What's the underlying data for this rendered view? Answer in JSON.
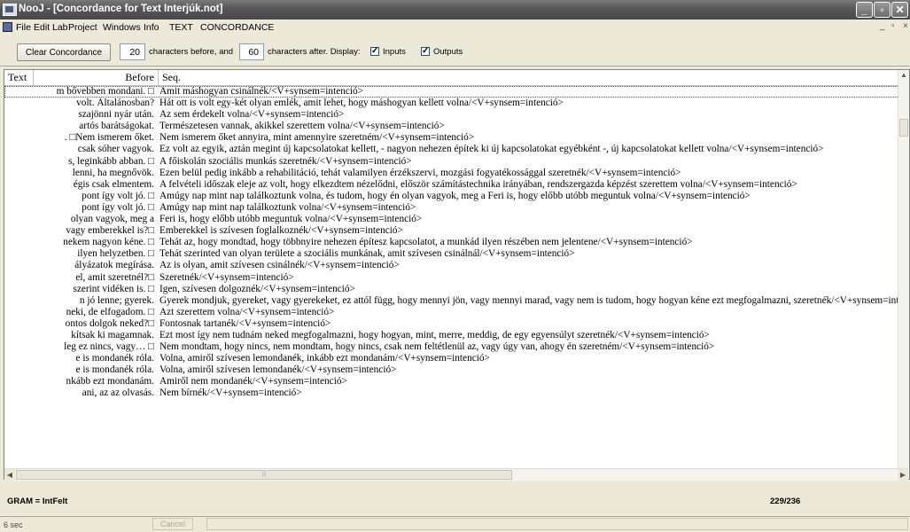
{
  "window": {
    "title": "NooJ - [Concordance for Text Interjúk.not]",
    "buttons": [
      "_",
      "▫",
      "✕"
    ]
  },
  "menu": {
    "items": [
      "File",
      "Edit",
      "Lab",
      "Project",
      "Windows",
      "Info",
      "TEXT",
      "CONCORDANCE"
    ],
    "right_controls": [
      "_",
      "▫",
      "×"
    ]
  },
  "toolbar": {
    "clear_label": "Clear Concordance",
    "chars_before": "20",
    "chars_before_label": "characters before, and",
    "chars_after": "60",
    "chars_after_label": "characters after.  Display:",
    "inputs_label": "Inputs",
    "inputs_checked": true,
    "outputs_label": "Outputs",
    "outputs_checked": true
  },
  "grid": {
    "columns": [
      "Text",
      "Before",
      "Seq."
    ],
    "rows": [
      {
        "before": "m bővebben mondani. □",
        "seq": "Amit máshogyan csinálnék/<V+synsem=intenció>"
      },
      {
        "before": "volt. Általánosban?",
        "seq": "Hát ott is volt egy-két olyan emlék, amit lehet, hogy máshogyan kellett volna/<V+synsem=intenció>"
      },
      {
        "before": "szajönni nyár után.",
        "seq": "Az sem érdekelt volna/<V+synsem=intenció>"
      },
      {
        "before": "artós barátságokat.",
        "seq": "Természetesen vannak, akikkel szerettem volna/<V+synsem=intenció>"
      },
      {
        "before": ". □Nem ismerem őket.",
        "seq": "Nem ismerem őket annyira, mint amennyire szeretném/<V+synsem=intenció>"
      },
      {
        "before": "csak sóher vagyok.",
        "seq": "Ez volt az egyik, aztán megint új kapcsolatokat kellett, - nagyon nehezen építek ki új kapcsolatokat egyébként -, új kapcsolatokat kellett volna/<V+synsem=intenció>"
      },
      {
        "before": "s, leginkább abban. □",
        "seq": "A főiskolán szociális munkás szeretnék/<V+synsem=intenció>"
      },
      {
        "before": "lenni, ha megnővök.",
        "seq": "Ezen belül pedig inkább a rehabilitáció, tehát valamilyen érzékszervi, mozgási fogyatékossággal szeretnék/<V+synsem=intenció>"
      },
      {
        "before": "égis csak elmentem.",
        "seq": "A felvételi időszak eleje az volt, hogy elkezdtem nézelődni, először számítástechnika irányában, rendszergazda képzést szerettem volna/<V+synsem=intenció>"
      },
      {
        "before": "pont így volt jó. □",
        "seq": "Amúgy nap mint nap találkoztunk volna, és tudom, hogy én olyan vagyok, meg a Feri is, hogy előbb utóbb meguntuk volna/<V+synsem=intenció>"
      },
      {
        "before": "pont így volt jó. □",
        "seq": "Amúgy nap mint nap találkoztunk volna/<V+synsem=intenció>"
      },
      {
        "before": "olyan vagyok, meg a",
        "seq": "Feri is, hogy előbb utóbb meguntuk volna/<V+synsem=intenció>"
      },
      {
        "before": "vagy emberekkel is?□",
        "seq": "Emberekkel is szívesen foglalkoznék/<V+synsem=intenció>"
      },
      {
        "before": "nekem nagyon kéne. □",
        "seq": "Tehát az, hogy mondtad, hogy többnyire nehezen építesz kapcsolatot, a munkád ilyen részében nem jelentene/<V+synsem=intenció>"
      },
      {
        "before": "ilyen helyzetben. □",
        "seq": "Tehát szerinted van olyan területe a szociális munkának, amit szívesen csinálnál/<V+synsem=intenció>"
      },
      {
        "before": "ályázatok megírása.",
        "seq": "Az is olyan, amit szívesen csinálnék/<V+synsem=intenció>"
      },
      {
        "before": "el, amit szeretnél?□",
        "seq": "Szeretnék/<V+synsem=intenció>"
      },
      {
        "before": "szerint vidéken is. □",
        "seq": "Igen, szívesen dolgoznék/<V+synsem=intenció>"
      },
      {
        "before": "n jó lenne; gyerek.",
        "seq": "Gyerek mondjuk, gyereket, vagy gyerekeket, ez attól függ, hogy mennyi jön, vagy mennyi marad, vagy nem is tudom, hogy hogyan kéne ezt megfogalmazni, szeretnék/<V+synsem=intenció>"
      },
      {
        "before": "neki, de elfogadom. □",
        "seq": "Azt szerettem volna/<V+synsem=intenció>"
      },
      {
        "before": "ontos dolgok neked?□",
        "seq": "Fontosnak tartanék/<V+synsem=intenció>"
      },
      {
        "before": "kítsak ki magamnak.",
        "seq": "Ezt most így nem tudnám neked megfogalmazni, hogy hogyan, mint, merre, meddig, de egy egyensúlyt szeretnék/<V+synsem=intenció>"
      },
      {
        "before": "leg ez nincs, vagy… □",
        "seq": "Nem mondtam, hogy nincs, nem mondtam, hogy nincs, csak nem feltétlenül az, vagy úgy van, ahogy én szeretném/<V+synsem=intenció>"
      },
      {
        "before": "e is mondanék róla.",
        "seq": "Volna, amiről szívesen lemondanék, inkább ezt mondanám/<V+synsem=intenció>"
      },
      {
        "before": "e is mondanék róla.",
        "seq": "Volna, amiről szívesen lemondanék/<V+synsem=intenció>"
      },
      {
        "before": "nkább ezt mondanám.",
        "seq": "Amiről nem mondanék/<V+synsem=intenció>"
      },
      {
        "before": "ani, az az olvasás.",
        "seq": "Nem bírnék/<V+synsem=intenció>"
      }
    ]
  },
  "status": {
    "grammar": "GRAM = IntFelt",
    "count": "229/236",
    "time": "6 sec",
    "cancel_label": "Cancel"
  }
}
